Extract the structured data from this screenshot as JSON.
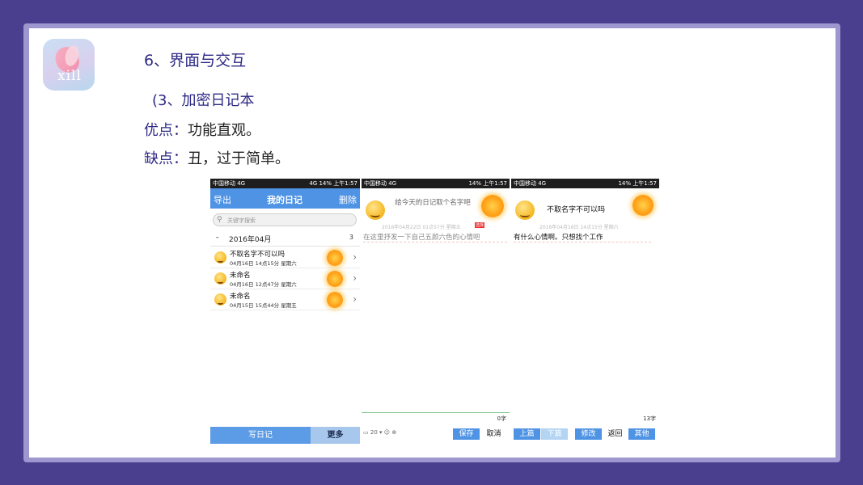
{
  "slide": {
    "title": "6、界面与交互",
    "subtitle": "(3、加密日记本",
    "pros_label": "优点：",
    "pros_value": "功能直观。",
    "cons_label": "缺点：",
    "cons_value": "丑，过于简单。",
    "logo_text": "xill"
  },
  "statusbar": {
    "carrier": "中国移动 4G",
    "signal": "4G",
    "battery": "14%",
    "time": "上午1:57"
  },
  "screen1": {
    "export_label": "导出",
    "header_title": "我的日记",
    "delete_label": "删除",
    "search_placeholder": "关键字搜索",
    "month_dash": "-",
    "month_label": "2016年04月",
    "month_count": "3",
    "entries": [
      {
        "title": "不取名字不可以吗",
        "date": "04月16日 14点15分 星期六",
        "mood": "sad"
      },
      {
        "title": "未命名",
        "date": "04月16日 12点47分 星期六",
        "mood": "happy"
      },
      {
        "title": "未命名",
        "date": "04月15日 15点44分 星期五",
        "mood": "happy"
      }
    ],
    "write_label": "写日记",
    "more_label": "更多"
  },
  "screen2": {
    "title_placeholder": "给今天的日记取个名字吧",
    "meta": "2016年04月22日 01点57分 星期五",
    "tag": "选择",
    "body_placeholder": "在这里抒发一下自己五颜六色的心情吧",
    "count": "0字",
    "font_size": "20",
    "save_label": "保存",
    "cancel_label": "取消"
  },
  "screen3": {
    "title": "不取名字不可以吗",
    "meta": "2016年04月16日 14点15分 星期六",
    "body": "有什么心情啊。只想找个工作",
    "count": "13字",
    "prev_label": "上篇",
    "next_label": "下篇",
    "edit_label": "修改",
    "back_label": "返回",
    "other_label": "其他"
  }
}
